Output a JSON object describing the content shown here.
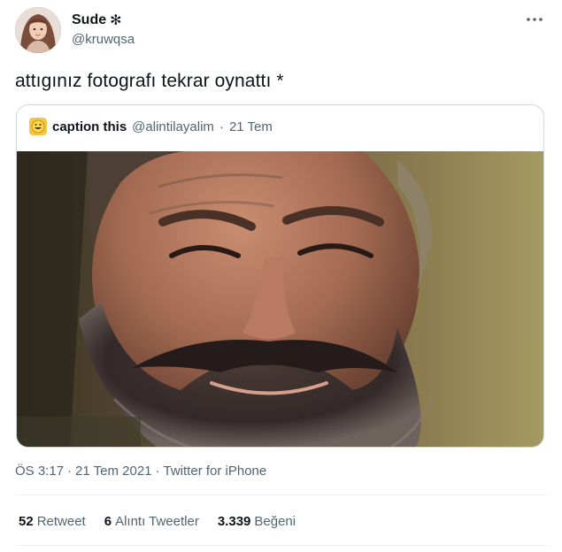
{
  "tweet": {
    "author": {
      "name": "Sude",
      "name_suffix": "✻",
      "handle": "@kruwqsa",
      "avatar_icon": "profile-photo"
    },
    "text": "attıgınız fotografı tekrar oynattı *",
    "more_icon": "ellipsis-icon",
    "quoted": {
      "avatar_icon": "grinning-emoji-icon",
      "name": "caption this",
      "handle": "@alintilayalim",
      "separator": "·",
      "date": "21 Tem",
      "media_icon": "smiling-bearded-man-photo"
    },
    "meta": {
      "time": "ÖS 3:17",
      "sep1": "·",
      "date": "21 Tem 2021",
      "sep2": "·",
      "client": "Twitter for iPhone"
    },
    "stats": {
      "retweets": {
        "count": "52",
        "label": "Retweet"
      },
      "quotes": {
        "count": "6",
        "label": "Alıntı Tweetler"
      },
      "likes": {
        "count": "3.339",
        "label": "Beğeni"
      }
    }
  },
  "colors": {
    "text_primary": "#0f1419",
    "text_secondary": "#536471",
    "border": "#cfd9de",
    "divider": "#eff3f4"
  }
}
